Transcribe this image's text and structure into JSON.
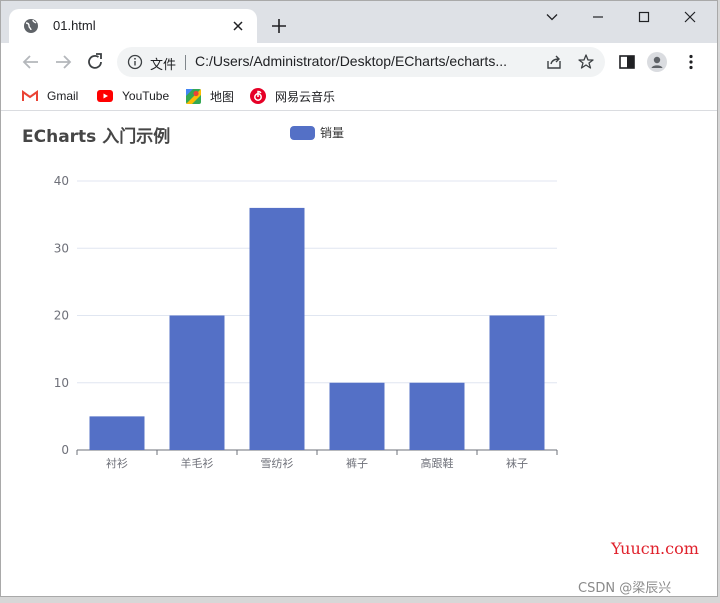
{
  "browser": {
    "tab_title": "01.html",
    "omnibox": {
      "file_label": "文件",
      "url": "C:/Users/Administrator/Desktop/ECharts/echarts..."
    },
    "bookmarks": [
      {
        "label": "Gmail",
        "icon": "gmail-icon"
      },
      {
        "label": "YouTube",
        "icon": "youtube-icon"
      },
      {
        "label": "地图",
        "icon": "maps-icon"
      },
      {
        "label": "网易云音乐",
        "icon": "netease-music-icon"
      }
    ]
  },
  "page": {
    "watermark_site": "Yuucn.com",
    "watermark_author": "CSDN @梁辰兴"
  },
  "colors": {
    "bar": "#5470c6",
    "tabstrip": "#dee1e6"
  },
  "chart_data": {
    "type": "bar",
    "title": "ECharts 入门示例",
    "categories": [
      "衬衫",
      "羊毛衫",
      "雪纺衫",
      "裤子",
      "高跟鞋",
      "袜子"
    ],
    "series": [
      {
        "name": "销量",
        "values": [
          5,
          20,
          36,
          10,
          10,
          20
        ]
      }
    ],
    "ylim": [
      0,
      40
    ],
    "yticks": [
      0,
      10,
      20,
      30,
      40
    ],
    "grid": true,
    "legend": "top-center"
  }
}
